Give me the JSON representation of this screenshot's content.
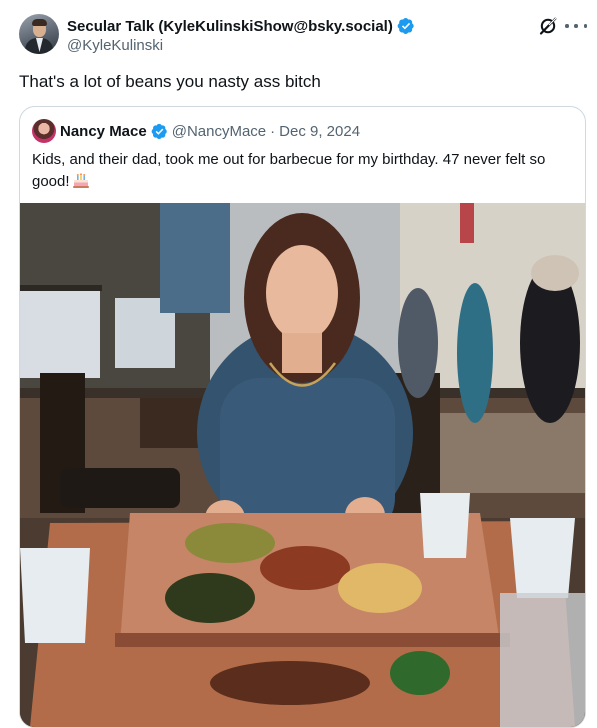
{
  "post": {
    "author_name": "Secular Talk (KyleKulinskiShow@bsky.social)",
    "handle": "@KyleKulinski",
    "text": "That's a lot of beans you nasty ass bitch"
  },
  "quoted_post": {
    "author_name": "Nancy Mace",
    "handle": "@NancyMace",
    "separator": "·",
    "date": "Dec 9, 2024",
    "text": "Kids, and their dad, took me out for barbecue for my birthday. 47 never felt so good!",
    "emoji": "birthday-cake-icon"
  },
  "icons": {
    "verified": "verified-badge-icon",
    "grok": "grok-icon",
    "more": "more-options-icon"
  },
  "colors": {
    "verified_blue": "#1d9bf0",
    "text_primary": "#0f1419",
    "text_secondary": "#536471",
    "border": "#cfd9de"
  }
}
